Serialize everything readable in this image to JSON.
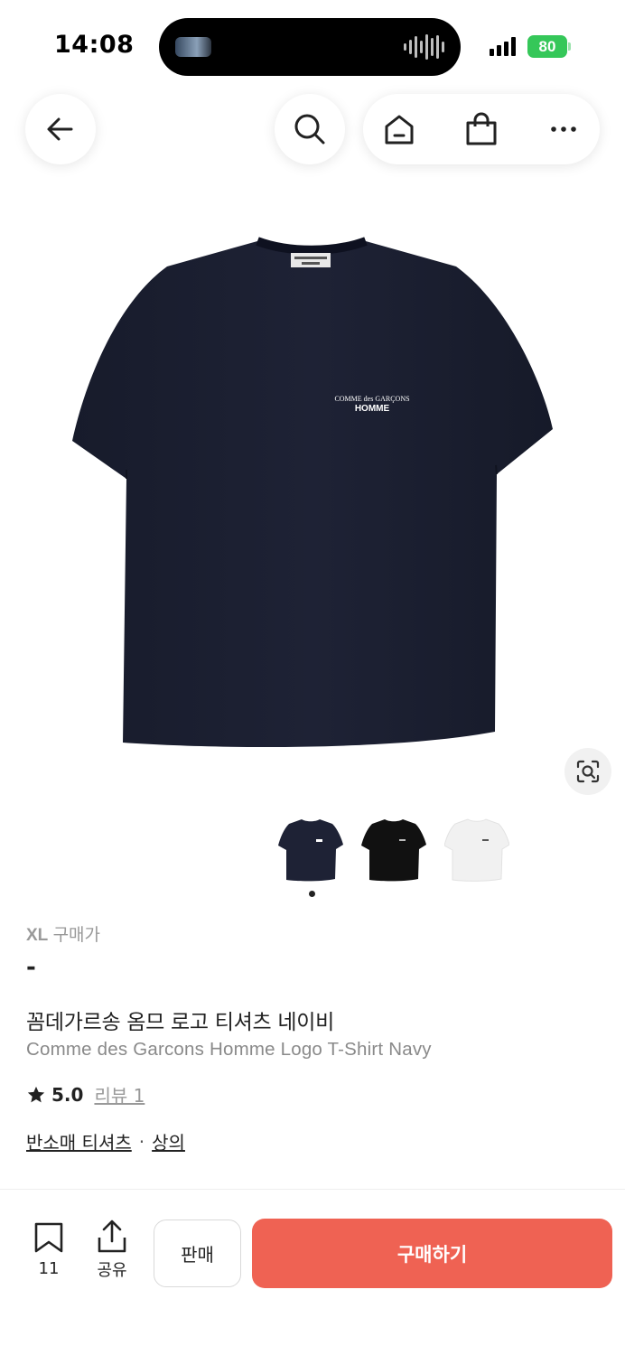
{
  "status_bar": {
    "time": "14:08",
    "battery": "80"
  },
  "product": {
    "size": "XL",
    "price_label": "구매가",
    "price": "-",
    "title_ko": "꼼데가르송 옴므 로고 티셔츠 네이비",
    "title_en": "Comme des Garcons Homme Logo T-Shirt Navy",
    "rating": "5.0",
    "review_text": "리뷰 1",
    "categories": [
      "반소매 티셔츠",
      "상의"
    ],
    "category_separator": "·",
    "image_logo_line1": "COMME des GARÇONS",
    "image_logo_line2": "HOMME"
  },
  "bottom_bar": {
    "bookmark_count": "11",
    "share_label": "공유",
    "sell_label": "판매",
    "buy_label": "구매하기"
  },
  "colors": {
    "buy": "#ef6253",
    "battery": "#35c759",
    "shirt_navy": "#1c2032"
  },
  "icons": [
    "back-arrow-icon",
    "search-icon",
    "home-icon",
    "shopping-bag-icon",
    "more-icon",
    "lens-icon",
    "bookmark-icon",
    "share-icon",
    "star-icon"
  ]
}
